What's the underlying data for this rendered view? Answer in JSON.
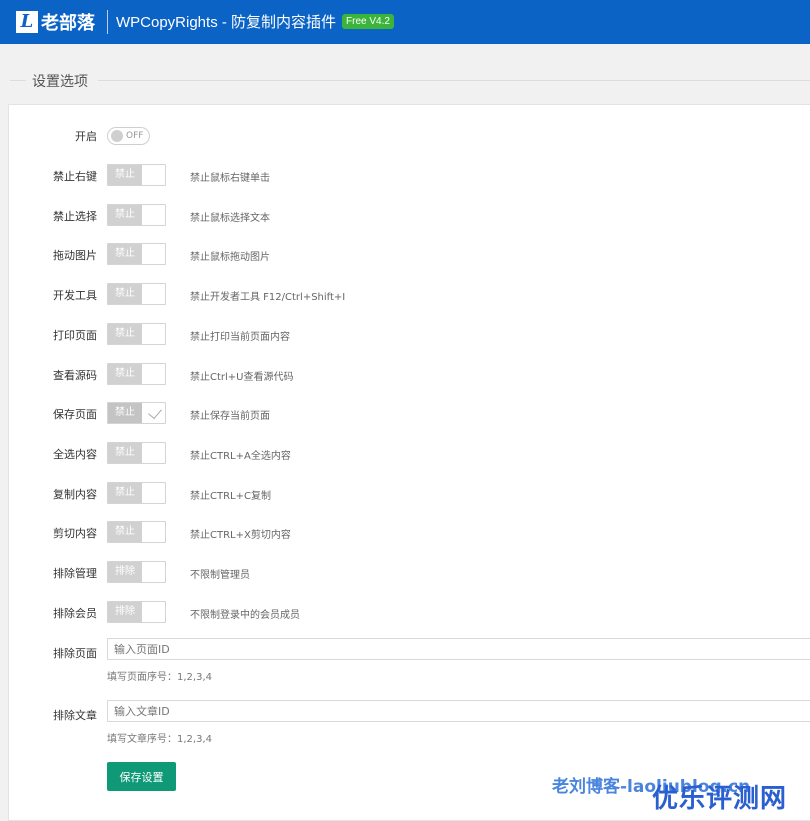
{
  "header": {
    "logo_mark": "L",
    "logo_text": "老部落",
    "title": "WPCopyRights - 防复制内容插件",
    "badge": "Free V4.2"
  },
  "section": {
    "title": "设置选项"
  },
  "enable": {
    "label": "开启",
    "state": "OFF"
  },
  "rows": [
    {
      "label": "禁止右键",
      "toggle": "禁止",
      "desc": "禁止鼠标右键单击",
      "checked": false
    },
    {
      "label": "禁止选择",
      "toggle": "禁止",
      "desc": "禁止鼠标选择文本",
      "checked": false
    },
    {
      "label": "拖动图片",
      "toggle": "禁止",
      "desc": "禁止鼠标拖动图片",
      "checked": false
    },
    {
      "label": "开发工具",
      "toggle": "禁止",
      "desc": "禁止开发者工具 F12/Ctrl+Shift+I",
      "checked": false
    },
    {
      "label": "打印页面",
      "toggle": "禁止",
      "desc": "禁止打印当前页面内容",
      "checked": false
    },
    {
      "label": "查看源码",
      "toggle": "禁止",
      "desc": "禁止Ctrl+U查看源代码",
      "checked": false
    },
    {
      "label": "保存页面",
      "toggle": "禁止",
      "desc": "禁止保存当前页面",
      "checked": true
    },
    {
      "label": "全选内容",
      "toggle": "禁止",
      "desc": "禁止CTRL+A全选内容",
      "checked": false
    },
    {
      "label": "复制内容",
      "toggle": "禁止",
      "desc": "禁止CTRL+C复制",
      "checked": false
    },
    {
      "label": "剪切内容",
      "toggle": "禁止",
      "desc": "禁止CTRL+X剪切内容",
      "checked": false
    },
    {
      "label": "排除管理",
      "toggle": "排除",
      "desc": "不限制管理员",
      "checked": false
    },
    {
      "label": "排除会员",
      "toggle": "排除",
      "desc": "不限制登录中的会员成员",
      "checked": false
    }
  ],
  "exclude_pages": {
    "label": "排除页面",
    "placeholder": "输入页面ID",
    "hint": "填写页面序号：1,2,3,4"
  },
  "exclude_posts": {
    "label": "排除文章",
    "placeholder": "输入文章ID",
    "hint": "填写文章序号：1,2,3,4"
  },
  "save_label": "保存设置",
  "watermark": {
    "small": "老刘博客-laoliublog.cn",
    "large": "优乐评测网"
  },
  "colors": {
    "header": "#0b63c6",
    "badge": "#3bb43b",
    "save": "#0f9977"
  }
}
